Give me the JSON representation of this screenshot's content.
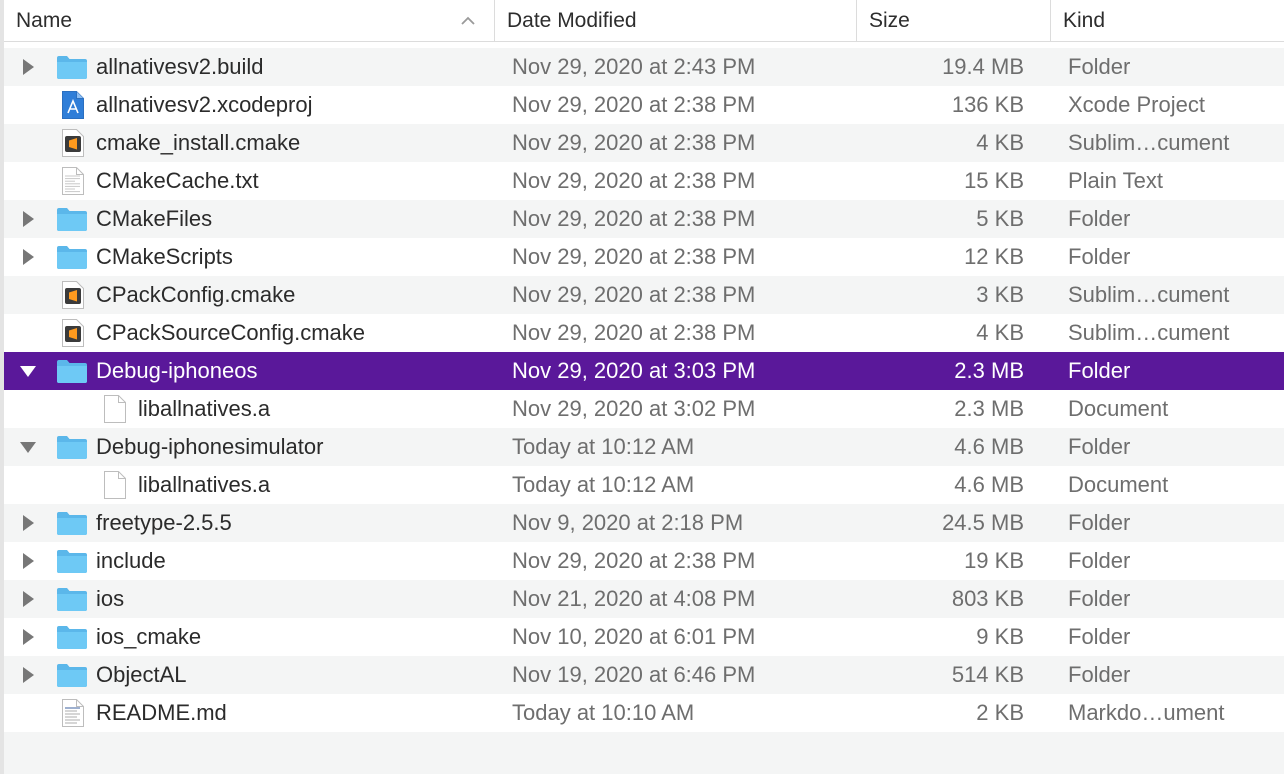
{
  "colors": {
    "selection": "#5a189a",
    "folder": "#5bbef0",
    "alt_row": "#f4f5f5"
  },
  "header": {
    "name": "Name",
    "date_modified": "Date Modified",
    "size": "Size",
    "kind": "Kind"
  },
  "rows": [
    {
      "name": "allnativesv2.build",
      "date": "Nov 29, 2020 at 2:43 PM",
      "size": "19.4 MB",
      "kind": "Folder",
      "icon": "folder-icon",
      "disclosure": "collapsed",
      "indent": 0
    },
    {
      "name": "allnativesv2.xcodeproj",
      "date": "Nov 29, 2020 at 2:38 PM",
      "size": "136 KB",
      "kind": "Xcode Project",
      "icon": "xcodeproj-icon",
      "disclosure": "none",
      "indent": 0
    },
    {
      "name": "cmake_install.cmake",
      "date": "Nov 29, 2020 at 2:38 PM",
      "size": "4 KB",
      "kind": "Sublim…cument",
      "icon": "sublime-doc-icon",
      "disclosure": "none",
      "indent": 0
    },
    {
      "name": "CMakeCache.txt",
      "date": "Nov 29, 2020 at 2:38 PM",
      "size": "15 KB",
      "kind": "Plain Text",
      "icon": "text-file-icon",
      "disclosure": "none",
      "indent": 0
    },
    {
      "name": "CMakeFiles",
      "date": "Nov 29, 2020 at 2:38 PM",
      "size": "5 KB",
      "kind": "Folder",
      "icon": "folder-icon",
      "disclosure": "collapsed",
      "indent": 0
    },
    {
      "name": "CMakeScripts",
      "date": "Nov 29, 2020 at 2:38 PM",
      "size": "12 KB",
      "kind": "Folder",
      "icon": "folder-icon",
      "disclosure": "collapsed",
      "indent": 0
    },
    {
      "name": "CPackConfig.cmake",
      "date": "Nov 29, 2020 at 2:38 PM",
      "size": "3 KB",
      "kind": "Sublim…cument",
      "icon": "sublime-doc-icon",
      "disclosure": "none",
      "indent": 0
    },
    {
      "name": "CPackSourceConfig.cmake",
      "date": "Nov 29, 2020 at 2:38 PM",
      "size": "4 KB",
      "kind": "Sublim…cument",
      "icon": "sublime-doc-icon",
      "disclosure": "none",
      "indent": 0
    },
    {
      "name": "Debug-iphoneos",
      "date": "Nov 29, 2020 at 3:03 PM",
      "size": "2.3 MB",
      "kind": "Folder",
      "icon": "folder-icon",
      "disclosure": "expanded",
      "indent": 0,
      "selected": true
    },
    {
      "name": "liballnatives.a",
      "date": "Nov 29, 2020 at 3:02 PM",
      "size": "2.3 MB",
      "kind": "Document",
      "icon": "blank-doc-icon",
      "disclosure": "none",
      "indent": 1
    },
    {
      "name": "Debug-iphonesimulator",
      "date": "Today at 10:12 AM",
      "size": "4.6 MB",
      "kind": "Folder",
      "icon": "folder-icon",
      "disclosure": "expanded",
      "indent": 0
    },
    {
      "name": "liballnatives.a",
      "date": "Today at 10:12 AM",
      "size": "4.6 MB",
      "kind": "Document",
      "icon": "blank-doc-icon",
      "disclosure": "none",
      "indent": 1
    },
    {
      "name": "freetype-2.5.5",
      "date": "Nov 9, 2020 at 2:18 PM",
      "size": "24.5 MB",
      "kind": "Folder",
      "icon": "folder-icon",
      "disclosure": "collapsed",
      "indent": 0
    },
    {
      "name": "include",
      "date": "Nov 29, 2020 at 2:38 PM",
      "size": "19 KB",
      "kind": "Folder",
      "icon": "folder-icon",
      "disclosure": "collapsed",
      "indent": 0
    },
    {
      "name": "ios",
      "date": "Nov 21, 2020 at 4:08 PM",
      "size": "803 KB",
      "kind": "Folder",
      "icon": "folder-icon",
      "disclosure": "collapsed",
      "indent": 0
    },
    {
      "name": "ios_cmake",
      "date": "Nov 10, 2020 at 6:01 PM",
      "size": "9 KB",
      "kind": "Folder",
      "icon": "folder-icon",
      "disclosure": "collapsed",
      "indent": 0
    },
    {
      "name": "ObjectAL",
      "date": "Nov 19, 2020 at 6:46 PM",
      "size": "514 KB",
      "kind": "Folder",
      "icon": "folder-icon",
      "disclosure": "collapsed",
      "indent": 0
    },
    {
      "name": "README.md",
      "date": "Today at 10:10 AM",
      "size": "2 KB",
      "kind": "Markdo…ument",
      "icon": "markdown-doc-icon",
      "disclosure": "none",
      "indent": 0
    }
  ]
}
